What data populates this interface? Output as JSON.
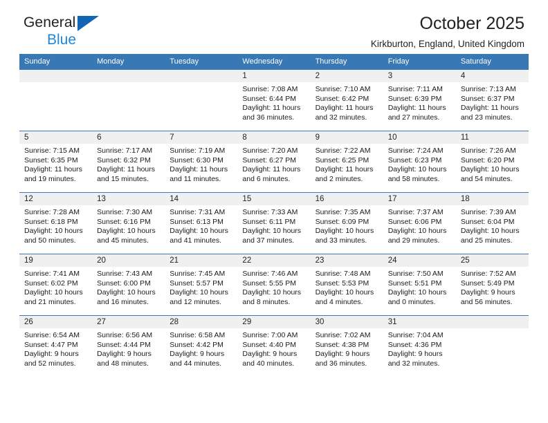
{
  "brand": {
    "line1": "General",
    "line2": "Blue",
    "accent": "#1f86d8",
    "triangle_color": "#1565b5"
  },
  "header": {
    "title": "October 2025",
    "subtitle": "Kirkburton, England, United Kingdom"
  },
  "theme": {
    "header_bg": "#3878b4",
    "daynum_bg": "#f0f0f0",
    "row_border": "#3878b4"
  },
  "weekdays": [
    "Sunday",
    "Monday",
    "Tuesday",
    "Wednesday",
    "Thursday",
    "Friday",
    "Saturday"
  ],
  "weeks": [
    [
      {
        "day": "",
        "lines": []
      },
      {
        "day": "",
        "lines": []
      },
      {
        "day": "",
        "lines": []
      },
      {
        "day": "1",
        "lines": [
          "Sunrise: 7:08 AM",
          "Sunset: 6:44 PM",
          "Daylight: 11 hours and 36 minutes."
        ]
      },
      {
        "day": "2",
        "lines": [
          "Sunrise: 7:10 AM",
          "Sunset: 6:42 PM",
          "Daylight: 11 hours and 32 minutes."
        ]
      },
      {
        "day": "3",
        "lines": [
          "Sunrise: 7:11 AM",
          "Sunset: 6:39 PM",
          "Daylight: 11 hours and 27 minutes."
        ]
      },
      {
        "day": "4",
        "lines": [
          "Sunrise: 7:13 AM",
          "Sunset: 6:37 PM",
          "Daylight: 11 hours and 23 minutes."
        ]
      }
    ],
    [
      {
        "day": "5",
        "lines": [
          "Sunrise: 7:15 AM",
          "Sunset: 6:35 PM",
          "Daylight: 11 hours and 19 minutes."
        ]
      },
      {
        "day": "6",
        "lines": [
          "Sunrise: 7:17 AM",
          "Sunset: 6:32 PM",
          "Daylight: 11 hours and 15 minutes."
        ]
      },
      {
        "day": "7",
        "lines": [
          "Sunrise: 7:19 AM",
          "Sunset: 6:30 PM",
          "Daylight: 11 hours and 11 minutes."
        ]
      },
      {
        "day": "8",
        "lines": [
          "Sunrise: 7:20 AM",
          "Sunset: 6:27 PM",
          "Daylight: 11 hours and 6 minutes."
        ]
      },
      {
        "day": "9",
        "lines": [
          "Sunrise: 7:22 AM",
          "Sunset: 6:25 PM",
          "Daylight: 11 hours and 2 minutes."
        ]
      },
      {
        "day": "10",
        "lines": [
          "Sunrise: 7:24 AM",
          "Sunset: 6:23 PM",
          "Daylight: 10 hours and 58 minutes."
        ]
      },
      {
        "day": "11",
        "lines": [
          "Sunrise: 7:26 AM",
          "Sunset: 6:20 PM",
          "Daylight: 10 hours and 54 minutes."
        ]
      }
    ],
    [
      {
        "day": "12",
        "lines": [
          "Sunrise: 7:28 AM",
          "Sunset: 6:18 PM",
          "Daylight: 10 hours and 50 minutes."
        ]
      },
      {
        "day": "13",
        "lines": [
          "Sunrise: 7:30 AM",
          "Sunset: 6:16 PM",
          "Daylight: 10 hours and 45 minutes."
        ]
      },
      {
        "day": "14",
        "lines": [
          "Sunrise: 7:31 AM",
          "Sunset: 6:13 PM",
          "Daylight: 10 hours and 41 minutes."
        ]
      },
      {
        "day": "15",
        "lines": [
          "Sunrise: 7:33 AM",
          "Sunset: 6:11 PM",
          "Daylight: 10 hours and 37 minutes."
        ]
      },
      {
        "day": "16",
        "lines": [
          "Sunrise: 7:35 AM",
          "Sunset: 6:09 PM",
          "Daylight: 10 hours and 33 minutes."
        ]
      },
      {
        "day": "17",
        "lines": [
          "Sunrise: 7:37 AM",
          "Sunset: 6:06 PM",
          "Daylight: 10 hours and 29 minutes."
        ]
      },
      {
        "day": "18",
        "lines": [
          "Sunrise: 7:39 AM",
          "Sunset: 6:04 PM",
          "Daylight: 10 hours and 25 minutes."
        ]
      }
    ],
    [
      {
        "day": "19",
        "lines": [
          "Sunrise: 7:41 AM",
          "Sunset: 6:02 PM",
          "Daylight: 10 hours and 21 minutes."
        ]
      },
      {
        "day": "20",
        "lines": [
          "Sunrise: 7:43 AM",
          "Sunset: 6:00 PM",
          "Daylight: 10 hours and 16 minutes."
        ]
      },
      {
        "day": "21",
        "lines": [
          "Sunrise: 7:45 AM",
          "Sunset: 5:57 PM",
          "Daylight: 10 hours and 12 minutes."
        ]
      },
      {
        "day": "22",
        "lines": [
          "Sunrise: 7:46 AM",
          "Sunset: 5:55 PM",
          "Daylight: 10 hours and 8 minutes."
        ]
      },
      {
        "day": "23",
        "lines": [
          "Sunrise: 7:48 AM",
          "Sunset: 5:53 PM",
          "Daylight: 10 hours and 4 minutes."
        ]
      },
      {
        "day": "24",
        "lines": [
          "Sunrise: 7:50 AM",
          "Sunset: 5:51 PM",
          "Daylight: 10 hours and 0 minutes."
        ]
      },
      {
        "day": "25",
        "lines": [
          "Sunrise: 7:52 AM",
          "Sunset: 5:49 PM",
          "Daylight: 9 hours and 56 minutes."
        ]
      }
    ],
    [
      {
        "day": "26",
        "lines": [
          "Sunrise: 6:54 AM",
          "Sunset: 4:47 PM",
          "Daylight: 9 hours and 52 minutes."
        ]
      },
      {
        "day": "27",
        "lines": [
          "Sunrise: 6:56 AM",
          "Sunset: 4:44 PM",
          "Daylight: 9 hours and 48 minutes."
        ]
      },
      {
        "day": "28",
        "lines": [
          "Sunrise: 6:58 AM",
          "Sunset: 4:42 PM",
          "Daylight: 9 hours and 44 minutes."
        ]
      },
      {
        "day": "29",
        "lines": [
          "Sunrise: 7:00 AM",
          "Sunset: 4:40 PM",
          "Daylight: 9 hours and 40 minutes."
        ]
      },
      {
        "day": "30",
        "lines": [
          "Sunrise: 7:02 AM",
          "Sunset: 4:38 PM",
          "Daylight: 9 hours and 36 minutes."
        ]
      },
      {
        "day": "31",
        "lines": [
          "Sunrise: 7:04 AM",
          "Sunset: 4:36 PM",
          "Daylight: 9 hours and 32 minutes."
        ]
      },
      {
        "day": "",
        "lines": []
      }
    ]
  ]
}
